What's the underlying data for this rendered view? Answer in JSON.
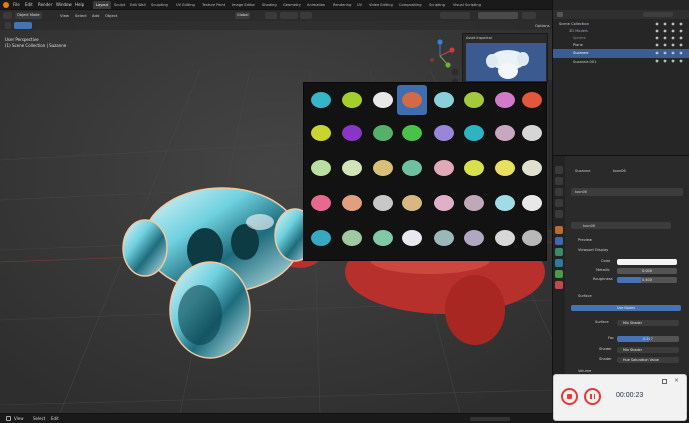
{
  "menu": {
    "items": [
      "File",
      "Edit",
      "Render",
      "Window",
      "Help"
    ],
    "workspaces": [
      "Layout",
      "Sculpt",
      "Edit Wall",
      "Sculpting",
      "UV Editing",
      "Texture Paint",
      "Image Editor",
      "Shading",
      "Geometry",
      "Animation",
      "Rendering",
      "UV",
      "Video Editing",
      "Compositing",
      "Scripting",
      "Visual Scripting"
    ],
    "active_workspace": "Layout",
    "scene": "Scene",
    "view_layer": "View Layer"
  },
  "viewport": {
    "mode": "Object Mode",
    "menus": [
      "View",
      "Select",
      "Add",
      "Object"
    ],
    "transform": "Global",
    "options": "Options",
    "info_line1": "User Perspective",
    "info_line2": "(1) Scene Collection | Suzanne"
  },
  "inspector": {
    "title": "Asset Inspector"
  },
  "outliner": {
    "rows": [
      {
        "label": "Scene Collection",
        "selected": false
      },
      {
        "label": "3D Models",
        "selected": false
      },
      {
        "label": "Sphere",
        "selected": false
      },
      {
        "label": "Plane",
        "selected": false
      },
      {
        "label": "Suzanne",
        "selected": true
      },
      {
        "label": "Suzanne.001",
        "selected": false
      }
    ]
  },
  "properties": {
    "object_name": "Suzanne",
    "material_name": "toon06",
    "slot_name": "toon06",
    "section_preview": "Preview",
    "section_viewport": "Viewport Display",
    "color_label": "Color",
    "metallic_label": "Metallic",
    "metallic_value": "0.000",
    "roughness_label": "Roughness",
    "roughness_value": "0.400",
    "section_surface": "Surface",
    "use_nodes": "Use Nodes",
    "surface_label": "Surface",
    "surface_value": "Mix Shader",
    "fac_label": "Fac",
    "fac_value": "0.517",
    "shader1_label": "Shader",
    "shader1_value": "Mix Shader",
    "shader2_label": "Shader",
    "shader2_value": "Hue Saturation Value",
    "section_volume": "Volume"
  },
  "statusbar": {
    "items": [
      "View",
      "Select",
      "Edit"
    ]
  },
  "recorder": {
    "time": "00:00:23",
    "record_color": "#e53935"
  },
  "icons": [
    "blender-logo-icon",
    "record-icon",
    "pause-icon",
    "search-icon",
    "eye-icon",
    "camera-icon",
    "expand-icon",
    "close-icon"
  ],
  "colors": {
    "accent": "#4772b3",
    "selection": "#3c5d94",
    "viewport_bg": "#3b3b3b"
  }
}
